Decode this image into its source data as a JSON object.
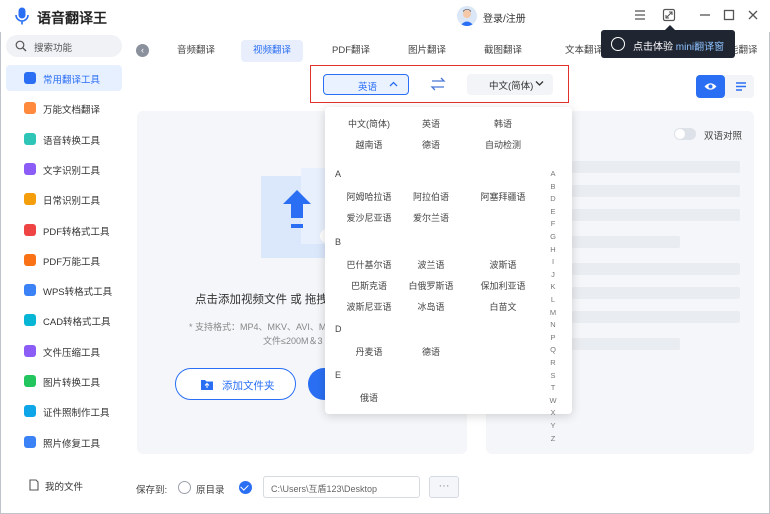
{
  "app": {
    "title": "语音翻译王",
    "login": "登录/注册"
  },
  "window_buttons": [
    "menu-icon",
    "shrink-icon",
    "minimize-icon",
    "maximize-icon",
    "close-icon"
  ],
  "search": {
    "placeholder": "搜索功能"
  },
  "sidebar": {
    "items": [
      {
        "label": "常用翻译工具",
        "icon": "translate-icon",
        "color": "#2a6ff3"
      },
      {
        "label": "万能文档翻译",
        "icon": "document-icon",
        "color": "#ff8a3d"
      },
      {
        "label": "语音转换工具",
        "icon": "voice-icon",
        "color": "#2ec4b6"
      },
      {
        "label": "文字识别工具",
        "icon": "text-recognition-icon",
        "color": "#8b5cf6"
      },
      {
        "label": "日常识别工具",
        "icon": "daily-recognition-icon",
        "color": "#f59e0b"
      },
      {
        "label": "PDF转格式工具",
        "icon": "pdf-convert-icon",
        "color": "#ef4444"
      },
      {
        "label": "PDF万能工具",
        "icon": "pdf-tools-icon",
        "color": "#f97316"
      },
      {
        "label": "WPS转格式工具",
        "icon": "wps-icon",
        "color": "#3b82f6"
      },
      {
        "label": "CAD转格式工具",
        "icon": "cad-icon",
        "color": "#06b6d4"
      },
      {
        "label": "文件压缩工具",
        "icon": "compress-icon",
        "color": "#8b5cf6"
      },
      {
        "label": "图片转换工具",
        "icon": "image-convert-icon",
        "color": "#22c55e"
      },
      {
        "label": "证件照制作工具",
        "icon": "id-photo-icon",
        "color": "#0ea5e9"
      },
      {
        "label": "照片修复工具",
        "icon": "photo-repair-icon",
        "color": "#3b82f6"
      }
    ],
    "my_files": "我的文件"
  },
  "tabs": [
    "音频翻译",
    "视频翻译",
    "PDF翻译",
    "图片翻译",
    "截图翻译",
    "文本翻译",
    "能翻译"
  ],
  "tooltip": {
    "prefix": "点击体验",
    "highlight": "mini翻译窗"
  },
  "language": {
    "source": "英语",
    "target": "中文(简体)"
  },
  "dropdown": {
    "common": [
      "中文(简体)",
      "英语",
      "韩语",
      "越南语",
      "德语",
      "自动检测"
    ],
    "groups": [
      {
        "letter": "A",
        "items": [
          "阿姆哈拉语",
          "阿拉伯语",
          "阿塞拜疆语",
          "爱沙尼亚语",
          "爱尔兰语"
        ]
      },
      {
        "letter": "B",
        "items": [
          "巴什基尔语",
          "波兰语",
          "波斯语",
          "巴斯克语",
          "白俄罗斯语",
          "保加利亚语",
          "波斯尼亚语",
          "冰岛语",
          "白苗文"
        ]
      },
      {
        "letter": "D",
        "items": [
          "丹麦语",
          "德语"
        ]
      },
      {
        "letter": "E",
        "items": [
          "俄语"
        ]
      }
    ],
    "alphabet": [
      "A",
      "B",
      "D",
      "E",
      "F",
      "G",
      "H",
      "I",
      "J",
      "K",
      "L",
      "M",
      "N",
      "P",
      "Q",
      "R",
      "S",
      "T",
      "W",
      "X",
      "Y",
      "Z"
    ]
  },
  "upload": {
    "main_text": "点击添加视频文件 或 拖拽",
    "formats": "* 支持格式：MP4、MKV、AVI、M",
    "size": "文件≤200M＆3",
    "add_folder": "添加文件夹"
  },
  "right_panel": {
    "dual_compare": "双语对照",
    "dual_compare_on": false
  },
  "save": {
    "label": "保存到:",
    "original_dir": "原目录",
    "path": "C:\\Users\\互盾123\\Desktop",
    "more": "···"
  },
  "colors": {
    "accent": "#2a6ff3",
    "highlight_box": "#e0312a",
    "tooltip_bg": "#1f2632"
  }
}
